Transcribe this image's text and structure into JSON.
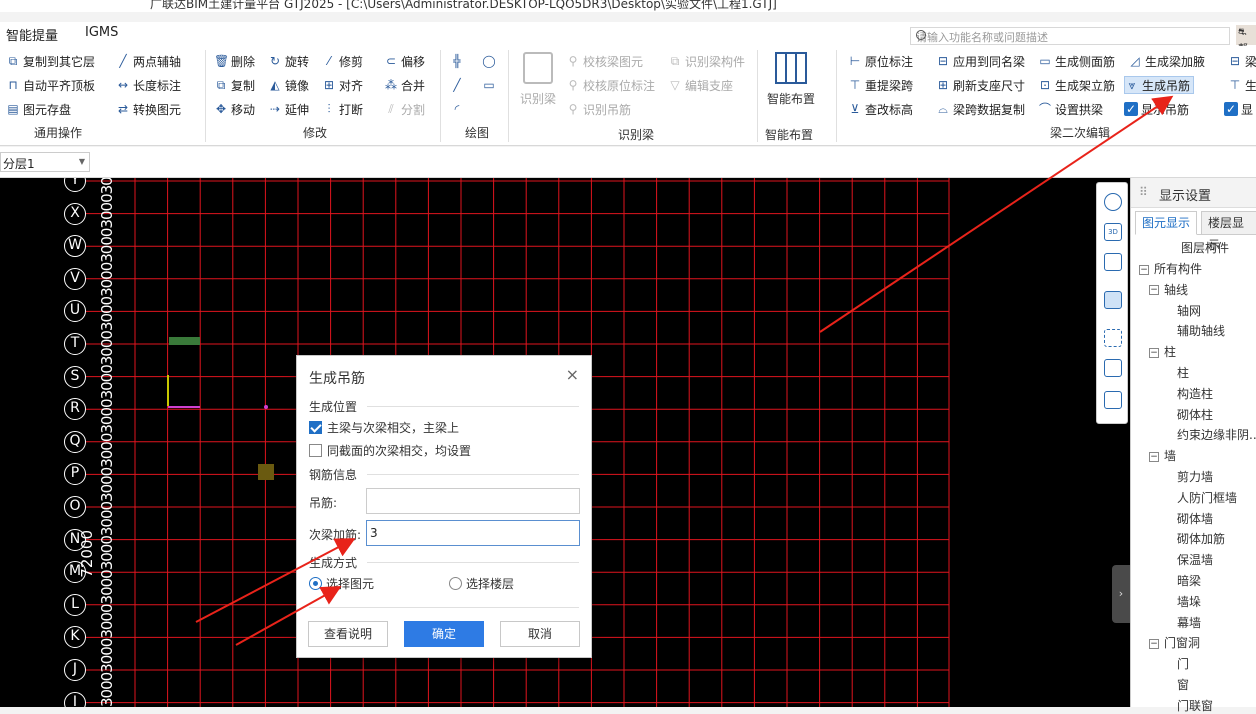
{
  "window": {
    "title": "广联达BIM土建计量平台 GTJ2025 - [C:\\Users\\Administrator.DESKTOP-LQO5DR3\\Desktop\\实验文件\\工程1.GTJ]"
  },
  "menu": {
    "items": [
      "智能提量",
      "IGMS"
    ]
  },
  "search": {
    "placeholder": "请输入功能名称或问题描述"
  },
  "corner_btn": "⛐ 帮",
  "ribbon": {
    "general": {
      "items": [
        "复制到其它层",
        "两点辅轴",
        "自动平齐顶板",
        "长度标注",
        "图元存盘",
        "转换图元"
      ],
      "label": "通用操作"
    },
    "modify": {
      "items": [
        "删除",
        "旋转",
        "修剪",
        "偏移",
        "复制",
        "镜像",
        "对齐",
        "合并",
        "移动",
        "延伸",
        "打断",
        "分割"
      ],
      "label": "修改"
    },
    "draw": {
      "label": "绘图"
    },
    "recognize": {
      "big": "识别梁",
      "items": [
        "校核梁图元",
        "识别梁构件",
        "校核原位标注",
        "编辑支座",
        "识别吊筋"
      ],
      "label": "识别梁"
    },
    "smart": {
      "big": "智能布置",
      "label": "智能布置"
    },
    "beam2": {
      "items": [
        "原位标注",
        "应用到同名梁",
        "生成侧面筋",
        "生成梁加腋",
        "重提梁跨",
        "刷新支座尺寸",
        "生成架立筋",
        "生成吊筋",
        "查改标高",
        "梁跨数据复制",
        "设置拱梁",
        "显示吊筋"
      ],
      "label": "梁二次编辑"
    },
    "extra": {
      "items": [
        "梁",
        "生",
        "显"
      ]
    }
  },
  "floor": {
    "selected": "分层1"
  },
  "canvas": {
    "axis_labels": [
      "Y",
      "X",
      "W",
      "V",
      "U",
      "T",
      "S",
      "R",
      "Q",
      "P",
      "O",
      "N",
      "M",
      "L",
      "K",
      "J",
      "I"
    ],
    "dim_text": "3000300030003000300030003000300030003000300030003000300030003000",
    "dim_total": "72000"
  },
  "right_panel": {
    "title": "显示设置",
    "tabs": [
      "图元显示",
      "楼层显示"
    ],
    "header": "图层构件",
    "tree": [
      {
        "label": "所有构件",
        "level": 0,
        "box": "−"
      },
      {
        "label": "轴线",
        "level": 1,
        "box": "−"
      },
      {
        "label": "轴网",
        "level": 2
      },
      {
        "label": "辅助轴线",
        "level": 2
      },
      {
        "label": "柱",
        "level": 1,
        "box": "−"
      },
      {
        "label": "柱",
        "level": 2
      },
      {
        "label": "构造柱",
        "level": 2
      },
      {
        "label": "砌体柱",
        "level": 2
      },
      {
        "label": "约束边缘非阴...",
        "level": 2
      },
      {
        "label": "墙",
        "level": 1,
        "box": "−"
      },
      {
        "label": "剪力墙",
        "level": 2
      },
      {
        "label": "人防门框墙",
        "level": 2
      },
      {
        "label": "砌体墙",
        "level": 2
      },
      {
        "label": "砌体加筋",
        "level": 2
      },
      {
        "label": "保温墙",
        "level": 2
      },
      {
        "label": "暗梁",
        "level": 2
      },
      {
        "label": "墙垛",
        "level": 2
      },
      {
        "label": "幕墙",
        "level": 2
      },
      {
        "label": "门窗洞",
        "level": 1,
        "box": "−"
      },
      {
        "label": "门",
        "level": 2
      },
      {
        "label": "窗",
        "level": 2
      },
      {
        "label": "门联窗",
        "level": 2
      }
    ]
  },
  "dialog": {
    "title": "生成吊筋",
    "close": "×",
    "section_position": "生成位置",
    "opt_main": "主梁与次梁相交，主梁上",
    "opt_same": "同截面的次梁相交，均设置",
    "section_rebar": "钢筋信息",
    "hanger_label": "吊筋:",
    "hanger_value": "",
    "secondary_label": "次梁加筋:",
    "secondary_value": "3",
    "section_method": "生成方式",
    "radio_element": "选择图元",
    "radio_floor": "选择楼层",
    "btn_help": "查看说明",
    "btn_ok": "确定",
    "btn_cancel": "取消"
  },
  "colors": {
    "grid": "#e0141e",
    "accent": "#1f6fc5",
    "annotation_arrow": "#e8231a"
  }
}
